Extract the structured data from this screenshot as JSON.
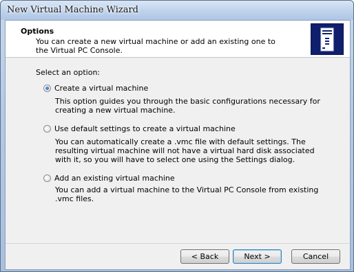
{
  "window": {
    "title": "New Virtual Machine Wizard"
  },
  "header": {
    "title": "Options",
    "description": "You can create a new virtual machine or add an existing one to the Virtual PC Console.",
    "icon": "virtual-pc-icon"
  },
  "prompt": "Select an option:",
  "options": [
    {
      "label": "Create a virtual machine",
      "checked": true,
      "description": "This option guides you through the basic configurations necessary for creating a new virtual machine."
    },
    {
      "label": "Use default settings to create a virtual machine",
      "checked": false,
      "description": "You can automatically create a .vmc file with default settings. The resulting virtual machine will not have a virtual hard disk associated with it, so you will have to select one using the Settings dialog."
    },
    {
      "label": "Add an existing virtual machine",
      "checked": false,
      "description": "You can add a virtual machine to the Virtual PC Console from existing .vmc files."
    }
  ],
  "buttons": {
    "back": "< Back",
    "next": "Next >",
    "cancel": "Cancel"
  },
  "colors": {
    "icon_bg": "#0f1f6e",
    "default_button_border": "#3c7fb1"
  }
}
